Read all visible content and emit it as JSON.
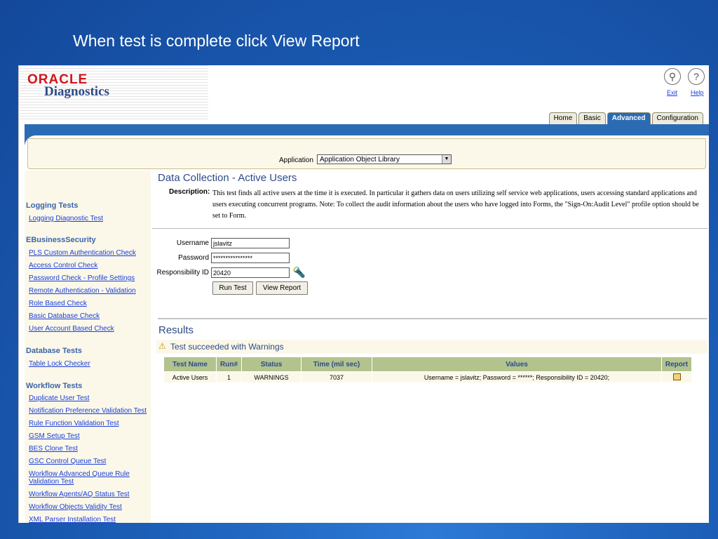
{
  "slide": {
    "title": "When test is complete click View Report"
  },
  "header": {
    "logo_oracle": "ORACLE",
    "logo_diagnostics": "Diagnostics",
    "exit_label": "Exit",
    "help_label": "Help",
    "tabs": [
      {
        "label": "Home"
      },
      {
        "label": "Basic"
      },
      {
        "label": "Advanced",
        "active": true
      },
      {
        "label": "Configuration"
      }
    ]
  },
  "application": {
    "label": "Application",
    "selected": "Application Object Library"
  },
  "sidebar": {
    "sections": [
      {
        "title": "Logging Tests",
        "links": [
          "Logging Diagnostic Test"
        ]
      },
      {
        "title": "EBusinessSecurity",
        "links": [
          "PLS Custom Authentication Check",
          "Access Control Check",
          "Password Check - Profile Settings",
          "Remote Authentication - Validation",
          "Role Based Check",
          "Basic Database Check",
          "User Account Based Check"
        ]
      },
      {
        "title": "Database Tests",
        "links": [
          "Table Lock Checker"
        ]
      },
      {
        "title": "Workflow Tests",
        "links": [
          "Duplicate User Test",
          "Notification Preference Validation Test",
          "Rule Function Validation Test",
          "GSM Setup Test",
          "BES Clone Test",
          "GSC Control Queue Test",
          "Workflow Advanced Queue Rule Validation Test",
          "Workflow Agents/AQ Status Test",
          "Workflow Objects Validity Test",
          "XML Parser Installation Test"
        ]
      }
    ]
  },
  "main": {
    "heading": "Data Collection - Active Users",
    "description_label": "Description:",
    "description": "This test finds all active users at the time it is executed. In particular it gathers data on users utilizing self service web applications, users accessing standard applications and users executing concurrent programs. Note: To collect the audit information about the users who have logged into Forms, the \"Sign-On:Audit Level\" profile option should be set to Form.",
    "form": {
      "username_label": "Username",
      "username_value": "jslavitz",
      "password_label": "Password",
      "password_value": "****************",
      "resp_label": "Responsibility ID",
      "resp_value": "20420",
      "run_button": "Run Test",
      "view_button": "View Report"
    },
    "results_heading": "Results",
    "status_message": "Test succeeded with Warnings",
    "table": {
      "headers": [
        "Test Name",
        "Run#",
        "Status",
        "Time (mil sec)",
        "Values",
        "Report"
      ],
      "rows": [
        [
          "Active Users",
          "1",
          "WARNINGS",
          "7037",
          "Username = jslavitz; Password = ******; Responsibility ID = 20420;",
          ""
        ]
      ]
    }
  },
  "colors": {
    "slide_background": "#1c5fb8",
    "oracle_red": "#d4141c",
    "heading_blue": "#2e4b86",
    "table_header": "#b2c38e",
    "panel_cream": "#fbf8ea"
  }
}
